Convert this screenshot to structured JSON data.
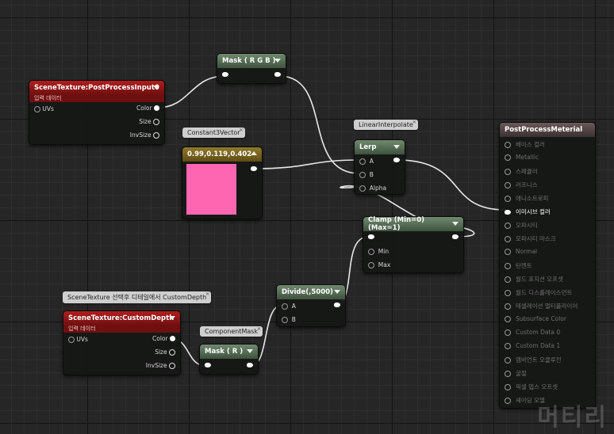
{
  "nodes": {
    "scene_texture_1": {
      "title": "SceneTexture:PostProcessInput0",
      "subtitle": "입력 데이터",
      "inputs": [
        "UVs"
      ],
      "outputs": [
        "Color",
        "Size",
        "InvSize"
      ]
    },
    "mask_rgb": {
      "title": "Mask ( R G B )"
    },
    "constant3": {
      "comment": "Constant3Vector",
      "title": "0.99,0.119,0.402",
      "color": "#ff66b2"
    },
    "lerp": {
      "comment": "LinearInterpolate",
      "title": "Lerp",
      "inputs": [
        "A",
        "B",
        "Alpha"
      ]
    },
    "clamp": {
      "title": "Clamp (Min=0) (Max=1)",
      "inputs": [
        "Min",
        "Max"
      ]
    },
    "divide": {
      "title": "Divide(,5000)",
      "inputs": [
        "A",
        "B"
      ]
    },
    "scene_texture_2": {
      "comment": "SceneTexture 선택후 디테일에서 CustomDepth",
      "title": "SceneTexture:CustomDepth",
      "subtitle": "입력 데이터",
      "inputs": [
        "UVs"
      ],
      "outputs": [
        "Color",
        "Size",
        "InvSize"
      ]
    },
    "mask_r": {
      "comment": "ComponentMask",
      "title": "Mask ( R )"
    },
    "final": {
      "title": "PostProcessMeterial",
      "pins": [
        "베이스 컬러",
        "Metallic",
        "스페큘러",
        "러프니스",
        "애니소트로피",
        "이미시브 컬러",
        "오파시티",
        "오파시티 마스크",
        "Normal",
        "탄젠트",
        "월드 포지션 오프셋",
        "월드 디스플레이스먼트",
        "테셀레이션 멀티플라이어",
        "Subsurface Color",
        "Custom Data 0",
        "Custom Data 1",
        "앰비언트 오클루전",
        "굴절",
        "픽셀 뎁스 오프셋",
        "셰이딩 모델"
      ],
      "active_index": 5
    }
  },
  "watermark": "머티리",
  "colors": {
    "wire": "#e8e8e8",
    "header_red": "#b31d1d",
    "header_green": "#5a725a"
  }
}
